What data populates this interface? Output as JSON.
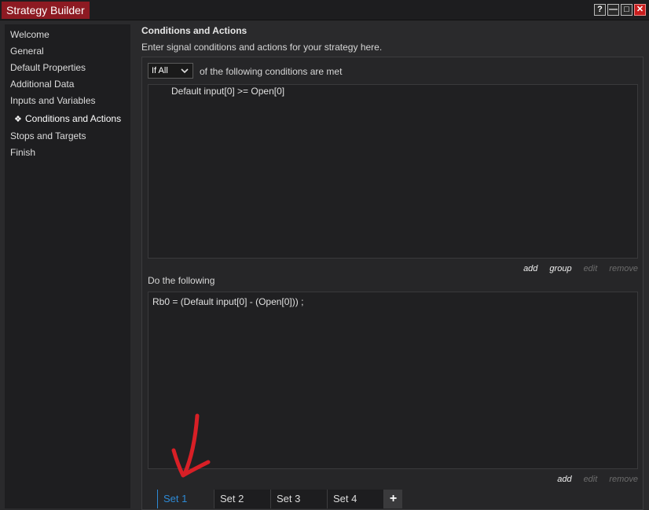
{
  "window": {
    "title": "Strategy Builder",
    "buttons": [
      "?",
      "—",
      "□",
      "✕"
    ]
  },
  "sidebar": {
    "items": [
      {
        "label": "Welcome"
      },
      {
        "label": "General"
      },
      {
        "label": "Default Properties"
      },
      {
        "label": "Additional Data"
      },
      {
        "label": "Inputs and Variables"
      },
      {
        "label": "Conditions and Actions",
        "active": true,
        "bullet": "❖"
      },
      {
        "label": "Stops and Targets"
      },
      {
        "label": "Finish"
      }
    ]
  },
  "main": {
    "heading": "Conditions and Actions",
    "subheading": "Enter signal conditions and actions for your strategy here.",
    "condition_mode": "If All",
    "condition_suffix": "of the following conditions are met",
    "conditions": [
      "Default input[0] >= Open[0]"
    ],
    "condition_actions": {
      "add": "add",
      "group": "group",
      "edit": "edit",
      "remove": "remove"
    },
    "do_label": "Do the following",
    "actions_list": [
      "Rb0 = (Default input[0] - (Open[0])) ;"
    ],
    "action_actions": {
      "add": "add",
      "edit": "edit",
      "remove": "remove"
    },
    "tabs": [
      {
        "label": "Set 1",
        "active": true
      },
      {
        "label": "Set 2"
      },
      {
        "label": "Set 3"
      },
      {
        "label": "Set 4"
      }
    ],
    "add_tab": "+"
  },
  "colors": {
    "title_accent": "#8d1a22",
    "active_tab": "#2d8ad6",
    "annotation_arrow": "#d81f26"
  },
  "icons": {
    "active_bullet": "diamond-bullet-icon",
    "annotation": "red-arrow-annotation-icon"
  }
}
